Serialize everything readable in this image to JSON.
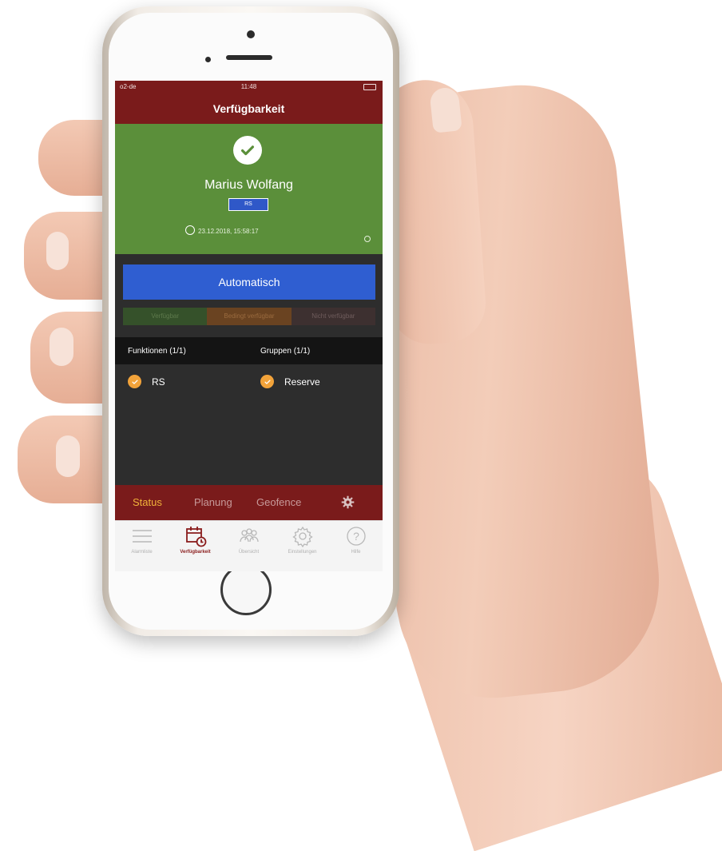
{
  "status_bar": {
    "carrier": "o2-de",
    "time": "11:48"
  },
  "header": {
    "title": "Verfügbarkeit"
  },
  "user": {
    "name": "Marius Wolfang",
    "badge": "RS",
    "timestamp": "23.12.2018, 15:58:17",
    "check_icon": "check-circle-icon",
    "status_color": "#5b8f3a"
  },
  "mode_button": {
    "label": "Automatisch",
    "color": "#2f5ed1"
  },
  "availability_segments": [
    {
      "label": "Verfügbar"
    },
    {
      "label": "Bedingt verfügbar"
    },
    {
      "label": "Nicht verfügbar"
    }
  ],
  "lists": {
    "functions_header": "Funktionen (1/1)",
    "groups_header": "Gruppen (1/1)",
    "function_items": [
      {
        "label": "RS"
      }
    ],
    "group_items": [
      {
        "label": "Reserve"
      }
    ]
  },
  "sub_tabs": {
    "items": [
      {
        "label": "Status",
        "active": true
      },
      {
        "label": "Planung"
      },
      {
        "label": "Geofence"
      }
    ],
    "settings_icon": "gear-icon",
    "active_color": "#f0b23a"
  },
  "bottom_nav": {
    "items": [
      {
        "label": "Alarmliste",
        "icon": "menu-lines-icon"
      },
      {
        "label": "Verfügbarkeit",
        "icon": "calendar-clock-icon",
        "active": true
      },
      {
        "label": "Übersicht",
        "icon": "people-icon"
      },
      {
        "label": "Einstellungen",
        "icon": "gear-icon"
      },
      {
        "label": "Hilfe",
        "icon": "question-circle-icon"
      }
    ],
    "active_color": "#8a1c1c"
  },
  "theme": {
    "primary": "#7a1b1b",
    "background": "#2d2d2d"
  }
}
